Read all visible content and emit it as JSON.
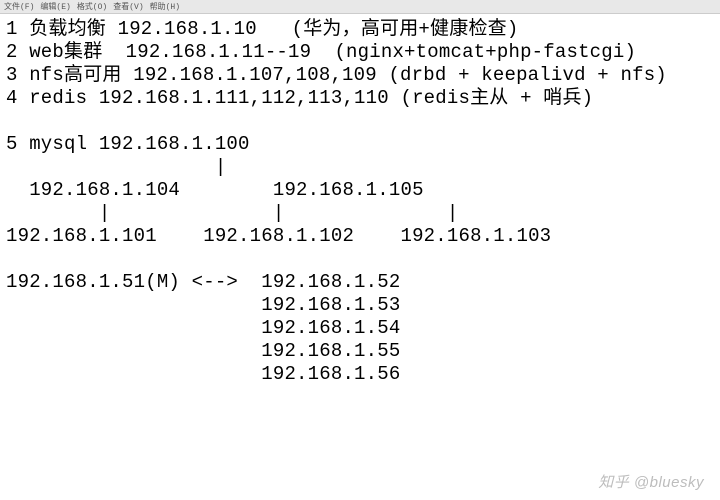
{
  "menubar": {
    "file": "文件(F)",
    "edit": "编辑(E)",
    "format": "格式(O)",
    "view": "查看(V)",
    "help": "帮助(H)"
  },
  "lines": {
    "l1": "1 负载均衡 192.168.1.10   (华为，高可用+健康检查)",
    "l2": "2 web集群  192.168.1.11--19  (nginx+tomcat+php-fastcgi)",
    "l3": "3 nfs高可用 192.168.1.107,108,109 (drbd + keepalivd + nfs)",
    "l4": "4 redis 192.168.1.111,112,113,110 (redis主从 + 哨兵)",
    "l5": "",
    "l6": "5 mysql 192.168.1.100",
    "l7": "                  |",
    "l8": "  192.168.1.104        192.168.1.105",
    "l9": "        |              |              |",
    "l10": "192.168.1.101    192.168.1.102    192.168.1.103",
    "l11": "",
    "l12": "192.168.1.51(M) <-->  192.168.1.52",
    "l13": "                      192.168.1.53",
    "l14": "                      192.168.1.54",
    "l15": "                      192.168.1.55",
    "l16": "                      192.168.1.56"
  },
  "watermark": "知乎 @bluesky"
}
